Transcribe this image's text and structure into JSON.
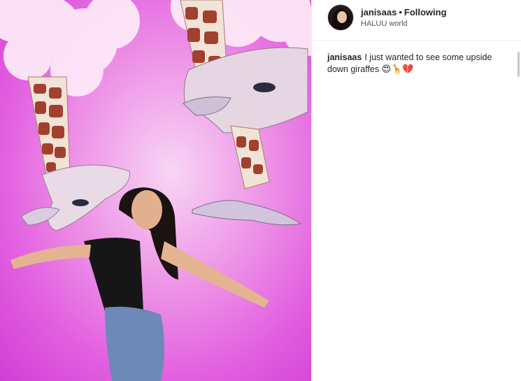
{
  "post": {
    "username": "janisaas",
    "separator": "•",
    "follow_status": "Following",
    "location": "HALUU world"
  },
  "caption": {
    "username": "janisaas",
    "text": "I just wanted to see some upside down giraffes",
    "emojis": "😍🦒💔"
  },
  "photo": {
    "subject": "woman posing with upside down giraffe sculptures",
    "background_color": "#e25fe0",
    "accent_color": "#cf3fd4"
  },
  "icons": {
    "avatar": "user-avatar",
    "scroll": "scrollbar-thumb"
  }
}
